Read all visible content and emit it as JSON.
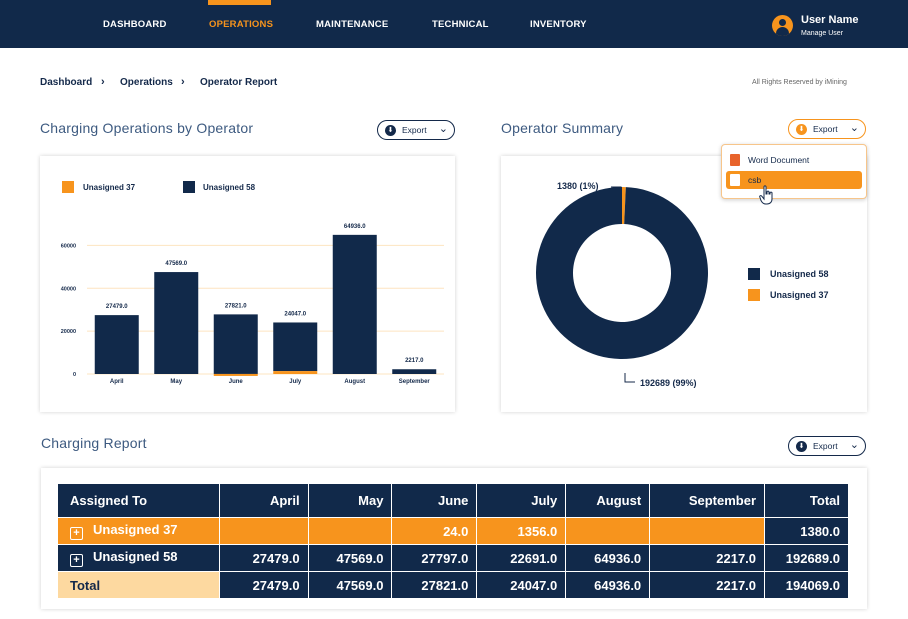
{
  "nav": {
    "items": [
      "DASHBOARD",
      "OPERATIONS",
      "MAINTENANCE",
      "TECHNICAL",
      "INVENTORY"
    ],
    "active": "OPERATIONS",
    "user_name": "User Name",
    "user_sub": "Manage User"
  },
  "breadcrumb": [
    "Dashboard",
    "Operations",
    "Operator Report"
  ],
  "rights": "All Rights Reserved by iMining",
  "bar_section": {
    "title": "Charging Operations by Operator",
    "export_label": "Export",
    "legend": [
      "Unasigned 37",
      "Unasigned 58"
    ]
  },
  "summary_section": {
    "title": "Operator Summary",
    "export_label": "Export",
    "dropdown": [
      "Word Document",
      "csb"
    ],
    "legend": [
      "Unasigned 58",
      "Unasigned 37"
    ],
    "label_small": "1380 (1%)",
    "label_large": "192689 (99%)"
  },
  "report_section": {
    "title": "Charging Report",
    "export_label": "Export",
    "headers": [
      "Assigned To",
      "April",
      "May",
      "June",
      "July",
      "August",
      "September",
      "Total"
    ],
    "rows": [
      [
        "Unasigned 37",
        "",
        "",
        "24.0",
        "1356.0",
        "",
        "",
        "1380.0"
      ],
      [
        "Unasigned 58",
        "27479.0",
        "47569.0",
        "27797.0",
        "22691.0",
        "64936.0",
        "2217.0",
        "192689.0"
      ]
    ],
    "total_row": [
      "Total",
      "27479.0",
      "47569.0",
      "27821.0",
      "24047.0",
      "64936.0",
      "2217.0",
      "194069.0"
    ]
  },
  "colors": {
    "navy": "#11294a",
    "orange": "#f7941d",
    "light_orange": "#fdd9a0"
  },
  "icons": [
    "user-icon",
    "chevron-right-icon",
    "download-icon",
    "chevron-down-icon",
    "word-icon",
    "file-icon",
    "plus-square-icon",
    "hand-cursor-icon"
  ],
  "chart_data": [
    {
      "type": "bar",
      "categories": [
        "April",
        "May",
        "June",
        "July",
        "August",
        "September"
      ],
      "series": [
        {
          "name": "Unasigned 37",
          "values": [
            0,
            0,
            24,
            1356,
            0,
            0
          ]
        },
        {
          "name": "Unasigned 58",
          "values": [
            27479,
            47569,
            27797,
            22691,
            64936,
            2217
          ]
        }
      ],
      "totals": [
        "27479.0",
        "47569.0",
        "27821.0",
        "24047.0",
        "64936.0",
        "2217.0"
      ],
      "yticks": [
        0,
        20000,
        40000,
        60000
      ],
      "ylim": [
        0,
        70000
      ],
      "legend_position": "top-left",
      "grid": true
    },
    {
      "type": "pie",
      "donut": true,
      "slices": [
        {
          "name": "Unasigned 37",
          "value": 1380
        },
        {
          "name": "Unasigned 58",
          "value": 192689
        }
      ],
      "legend_position": "right"
    }
  ]
}
